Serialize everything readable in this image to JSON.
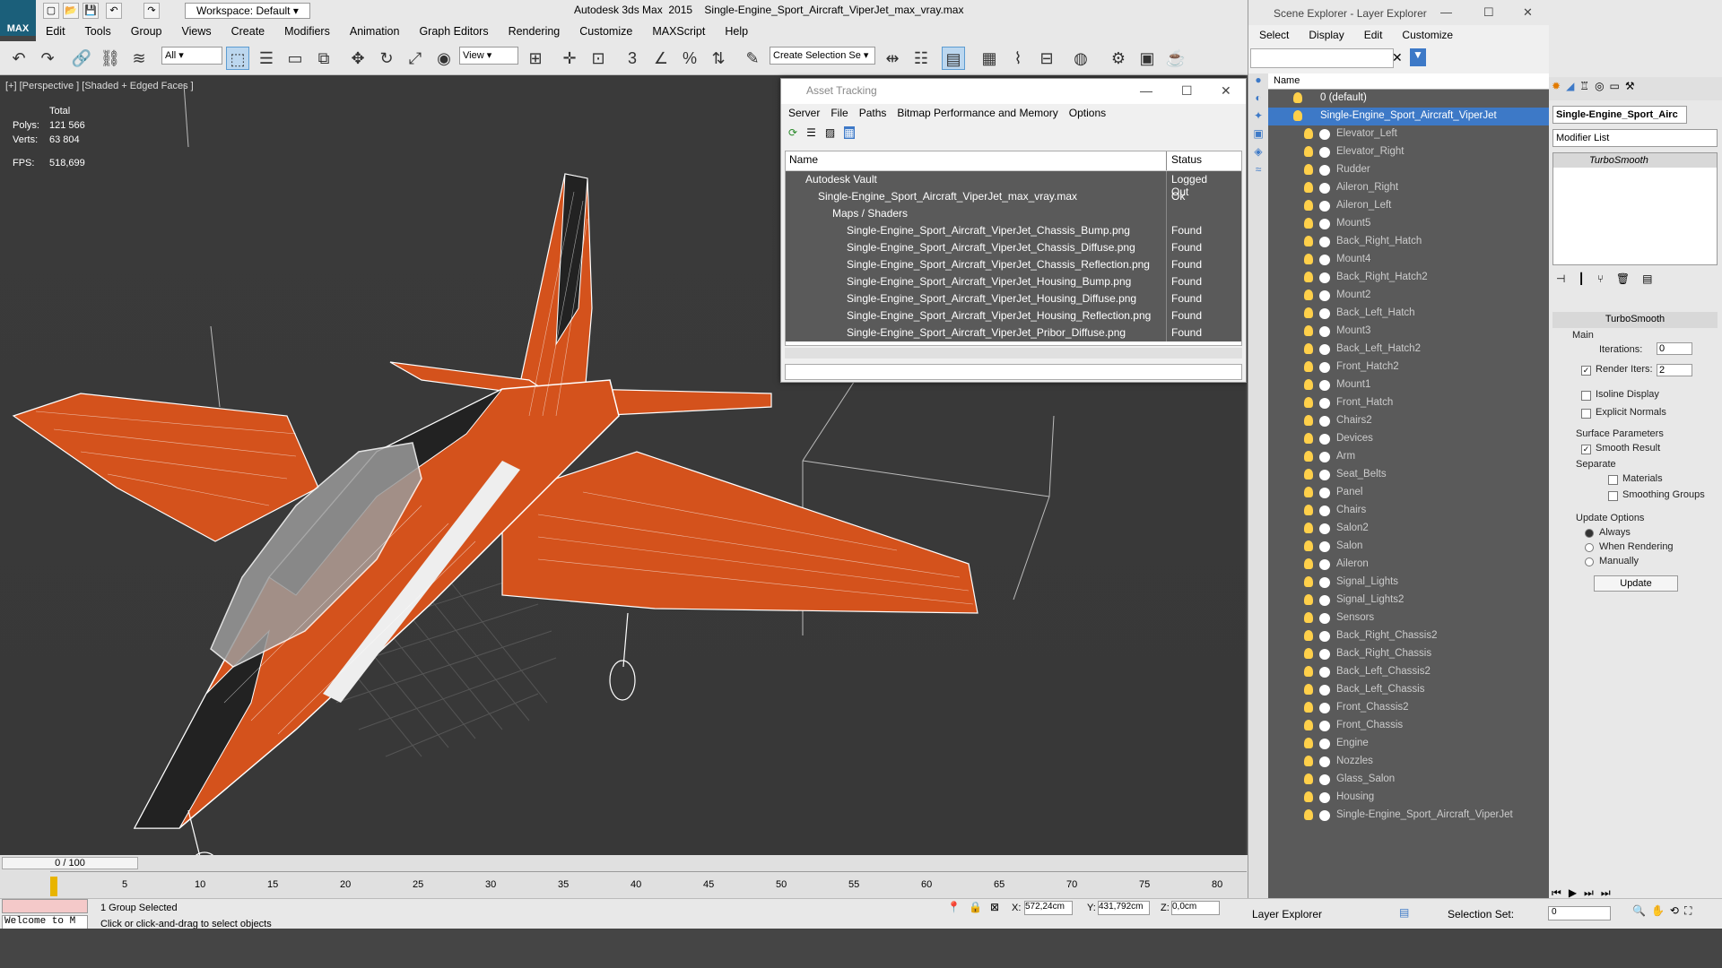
{
  "app": {
    "title": "Autodesk 3ds Max  2015    Single-Engine_Sport_Aircraft_ViperJet_max_vray.max",
    "logo": "MAX",
    "workspace": "Workspace: Default"
  },
  "menu": [
    "Edit",
    "Tools",
    "Group",
    "Views",
    "Create",
    "Modifiers",
    "Animation",
    "Graph Editors",
    "Rendering",
    "Customize",
    "MAXScript",
    "Help"
  ],
  "toolbar": {
    "selection_filter": "All",
    "ref_coord": "View",
    "named_selection": "Create Selection Se"
  },
  "viewport": {
    "label": "[+] [Perspective ] [Shaded + Edged Faces ]",
    "stats_total": "Total",
    "polys_label": "Polys:",
    "polys_value": "121 566",
    "verts_label": "Verts:",
    "verts_value": "63 804",
    "fps_label": "FPS:",
    "fps_value": "518,699"
  },
  "asset_tracking": {
    "title": "Asset Tracking",
    "menu": [
      "Server",
      "File",
      "Paths",
      "Bitmap Performance and Memory",
      "Options"
    ],
    "columns": [
      "Name",
      "Status"
    ],
    "rows": [
      {
        "name": "Autodesk Vault",
        "status": "Logged Out"
      },
      {
        "name": "Single-Engine_Sport_Aircraft_ViperJet_max_vray.max",
        "status": "Ok"
      },
      {
        "name": "Maps / Shaders",
        "status": ""
      },
      {
        "name": "Single-Engine_Sport_Aircraft_ViperJet_Chassis_Bump.png",
        "status": "Found"
      },
      {
        "name": "Single-Engine_Sport_Aircraft_ViperJet_Chassis_Diffuse.png",
        "status": "Found"
      },
      {
        "name": "Single-Engine_Sport_Aircraft_ViperJet_Chassis_Reflection.png",
        "status": "Found"
      },
      {
        "name": "Single-Engine_Sport_Aircraft_ViperJet_Housing_Bump.png",
        "status": "Found"
      },
      {
        "name": "Single-Engine_Sport_Aircraft_ViperJet_Housing_Diffuse.png",
        "status": "Found"
      },
      {
        "name": "Single-Engine_Sport_Aircraft_ViperJet_Housing_Reflection.png",
        "status": "Found"
      },
      {
        "name": "Single-Engine_Sport_Aircraft_ViperJet_Pribor_Diffuse.png",
        "status": "Found"
      }
    ]
  },
  "scene_explorer": {
    "title": "Scene Explorer - Layer Explorer",
    "menu": [
      "Select",
      "Display",
      "Edit",
      "Customize"
    ],
    "column": "Name",
    "default_layer": "0 (default)",
    "selected_layer": "Single-Engine_Sport_Aircraft_ViperJet",
    "items": [
      "Elevator_Left",
      "Elevator_Right",
      "Rudder",
      "Aileron_Right",
      "Aileron_Left",
      "Mount5",
      "Back_Right_Hatch",
      "Mount4",
      "Back_Right_Hatch2",
      "Mount2",
      "Back_Left_Hatch",
      "Mount3",
      "Back_Left_Hatch2",
      "Front_Hatch2",
      "Mount1",
      "Front_Hatch",
      "Chairs2",
      "Devices",
      "Arm",
      "Seat_Belts",
      "Panel",
      "Chairs",
      "Salon2",
      "Salon",
      "Aileron",
      "Signal_Lights",
      "Signal_Lights2",
      "Sensors",
      "Back_Right_Chassis2",
      "Back_Right_Chassis",
      "Back_Left_Chassis2",
      "Back_Left_Chassis",
      "Front_Chassis2",
      "Front_Chassis",
      "Engine",
      "Nozzles",
      "Glass_Salon",
      "Housing",
      "Single-Engine_Sport_Aircraft_ViperJet"
    ],
    "footer_label": "Layer Explorer",
    "selection_set_label": "Selection Set:"
  },
  "command_panel": {
    "object_name": "Single-Engine_Sport_Airc",
    "modifier_list": "Modifier List",
    "modifier": "TurboSmooth",
    "rollout_title": "TurboSmooth",
    "main_label": "Main",
    "iterations_label": "Iterations:",
    "iterations_value": "0",
    "render_iters_label": "Render Iters:",
    "render_iters_value": "2",
    "isoline_label": "Isoline Display",
    "explicit_label": "Explicit Normals",
    "surface_label": "Surface Parameters",
    "smooth_label": "Smooth Result",
    "separate_label": "Separate",
    "materials_label": "Materials",
    "smoothing_label": "Smoothing Groups",
    "update_options_label": "Update Options",
    "always_label": "Always",
    "when_rendering_label": "When Rendering",
    "manually_label": "Manually",
    "update_button": "Update"
  },
  "timeline": {
    "frame": "0 / 100",
    "ticks": [
      "5",
      "10",
      "15",
      "20",
      "25",
      "30",
      "35",
      "40",
      "45",
      "50",
      "55",
      "60",
      "65",
      "70",
      "75",
      "80"
    ]
  },
  "status": {
    "selected": "1 Group Selected",
    "prompt": "Click or click-and-drag to select objects",
    "welcome": "Welcome to M",
    "x_label": "X:",
    "x_value": "572,24cm",
    "y_label": "Y:",
    "y_value": "431,792cm",
    "z_label": "Z:",
    "z_value": "0,0cm",
    "selection_set_value": "0"
  },
  "colors": {
    "accent": "#3d79c7",
    "aircraft_orange": "#d4521c",
    "list_bg": "#5a5a5a"
  }
}
